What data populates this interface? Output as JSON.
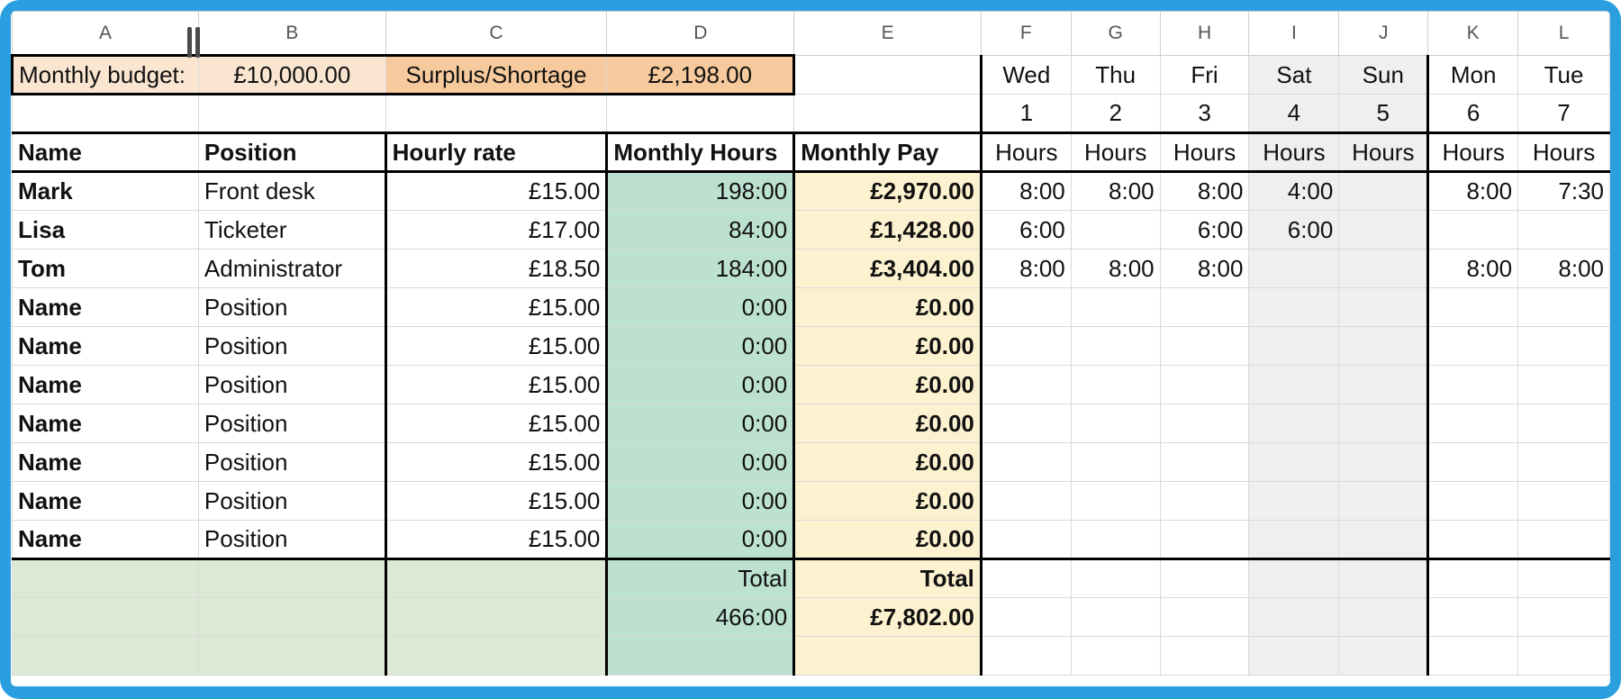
{
  "columns": [
    "A",
    "B",
    "C",
    "D",
    "E",
    "F",
    "G",
    "H",
    "I",
    "J",
    "K",
    "L"
  ],
  "budget": {
    "label": "Monthly budget:",
    "value": "£10,000.00",
    "surplus_label": "Surplus/Shortage",
    "surplus_value": "£2,198.00"
  },
  "days": {
    "names": [
      "Wed",
      "Thu",
      "Fri",
      "Sat",
      "Sun",
      "Mon",
      "Tue"
    ],
    "numbers": [
      "1",
      "2",
      "3",
      "4",
      "5",
      "6",
      "7"
    ],
    "unit": "Hours"
  },
  "headers": {
    "name": "Name",
    "position": "Position",
    "hourly_rate": "Hourly rate",
    "monthly_hours": "Monthly Hours",
    "monthly_pay": "Monthly Pay"
  },
  "rows": [
    {
      "name": "Mark",
      "position": "Front desk",
      "rate": "£15.00",
      "hours": "198:00",
      "pay": "£2,970.00",
      "days": [
        "8:00",
        "8:00",
        "8:00",
        "4:00",
        "",
        "8:00",
        "7:30"
      ]
    },
    {
      "name": "Lisa",
      "position": "Ticketer",
      "rate": "£17.00",
      "hours": "84:00",
      "pay": "£1,428.00",
      "days": [
        "6:00",
        "",
        "6:00",
        "6:00",
        "",
        "",
        ""
      ]
    },
    {
      "name": "Tom",
      "position": "Administrator",
      "rate": "£18.50",
      "hours": "184:00",
      "pay": "£3,404.00",
      "days": [
        "8:00",
        "8:00",
        "8:00",
        "",
        "",
        "8:00",
        "8:00"
      ]
    },
    {
      "name": "Name",
      "position": "Position",
      "rate": "£15.00",
      "hours": "0:00",
      "pay": "£0.00",
      "days": [
        "",
        "",
        "",
        "",
        "",
        "",
        ""
      ]
    },
    {
      "name": "Name",
      "position": "Position",
      "rate": "£15.00",
      "hours": "0:00",
      "pay": "£0.00",
      "days": [
        "",
        "",
        "",
        "",
        "",
        "",
        ""
      ]
    },
    {
      "name": "Name",
      "position": "Position",
      "rate": "£15.00",
      "hours": "0:00",
      "pay": "£0.00",
      "days": [
        "",
        "",
        "",
        "",
        "",
        "",
        ""
      ]
    },
    {
      "name": "Name",
      "position": "Position",
      "rate": "£15.00",
      "hours": "0:00",
      "pay": "£0.00",
      "days": [
        "",
        "",
        "",
        "",
        "",
        "",
        ""
      ]
    },
    {
      "name": "Name",
      "position": "Position",
      "rate": "£15.00",
      "hours": "0:00",
      "pay": "£0.00",
      "days": [
        "",
        "",
        "",
        "",
        "",
        "",
        ""
      ]
    },
    {
      "name": "Name",
      "position": "Position",
      "rate": "£15.00",
      "hours": "0:00",
      "pay": "£0.00",
      "days": [
        "",
        "",
        "",
        "",
        "",
        "",
        ""
      ]
    },
    {
      "name": "Name",
      "position": "Position",
      "rate": "£15.00",
      "hours": "0:00",
      "pay": "£0.00",
      "days": [
        "",
        "",
        "",
        "",
        "",
        "",
        ""
      ]
    }
  ],
  "totals": {
    "hours_label": "Total",
    "pay_label": "Total",
    "hours": "466:00",
    "pay": "£7,802.00"
  },
  "colors": {
    "frame": "#2b9ee0",
    "hours_fill": "#bce1d0",
    "pay_fill": "#fdf2cf",
    "footer_fill": "#dce9d5",
    "budget_fill": "#fae5d1",
    "surplus_fill": "#f6ca9c",
    "weekend_fill": "#efefef"
  }
}
